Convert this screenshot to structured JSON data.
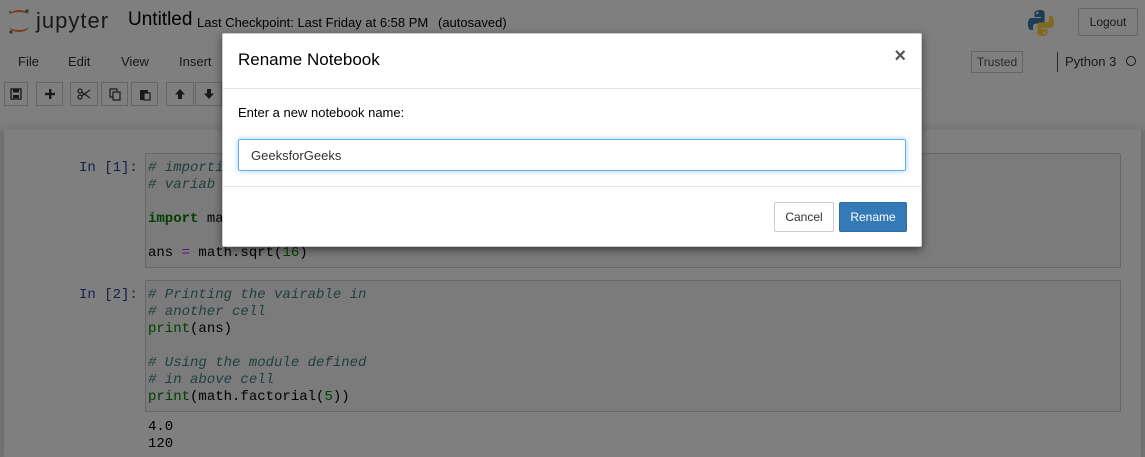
{
  "header": {
    "logo_text": "jupyter",
    "notebook_title": "Untitled",
    "checkpoint": "Last Checkpoint: Last Friday at 6:58 PM",
    "autosave": "(autosaved)",
    "logout_label": "Logout"
  },
  "menubar": {
    "items": [
      "File",
      "Edit",
      "View",
      "Insert"
    ],
    "trusted_label": "Trusted",
    "kernel_name": "Python 3"
  },
  "toolbar": {
    "buttons": [
      "save-icon",
      "add-cell-icon",
      "cut-icon",
      "copy-icon",
      "paste-icon",
      "move-up-icon",
      "move-down-icon"
    ]
  },
  "cells": [
    {
      "prompt": "In [1]:",
      "lines": [
        {
          "type": "comment",
          "text": "# importi"
        },
        {
          "type": "comment",
          "text": "# variab"
        },
        {
          "type": "blank",
          "text": ""
        },
        {
          "type": "import",
          "keyword": "import",
          "rest": " ma"
        },
        {
          "type": "blank",
          "text": ""
        },
        {
          "type": "code",
          "pre": "ans ",
          "op": "=",
          "mid": " math.sqrt(",
          "num": "16",
          "post": ")"
        }
      ]
    },
    {
      "prompt": "In [2]:",
      "lines": [
        {
          "type": "comment",
          "text": "# Printing the vairable in"
        },
        {
          "type": "comment",
          "text": "# another cell"
        },
        {
          "type": "call",
          "fn": "print",
          "rest": "(ans)"
        },
        {
          "type": "blank",
          "text": ""
        },
        {
          "type": "comment",
          "text": "# Using the module defined"
        },
        {
          "type": "comment",
          "text": "# in above cell"
        },
        {
          "type": "call2",
          "fn": "print",
          "mid": "(math.factorial(",
          "num": "5",
          "post": "))"
        }
      ],
      "output": [
        "4.0",
        "120"
      ]
    }
  ],
  "modal": {
    "title": "Rename Notebook",
    "close_symbol": "×",
    "label": "Enter a new notebook name:",
    "input_value": "GeeksforGeeks",
    "cancel_label": "Cancel",
    "rename_label": "Rename"
  },
  "colors": {
    "primary": "#337ab7",
    "prompt": "#303f9f",
    "comment": "#408080",
    "keyword": "#008000"
  }
}
